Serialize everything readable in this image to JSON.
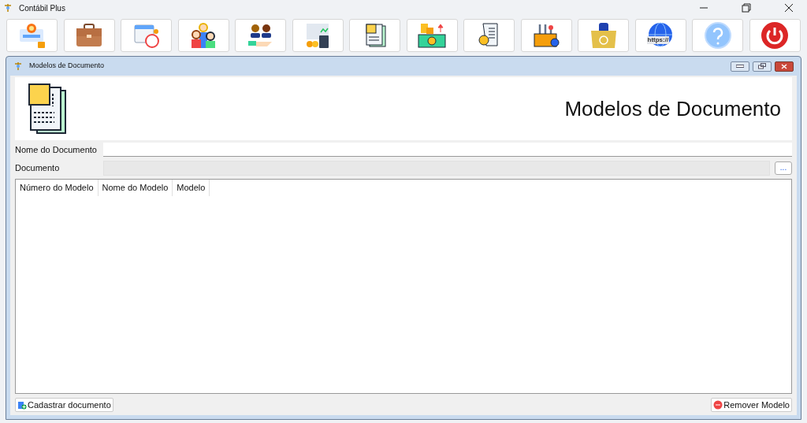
{
  "app": {
    "title": "Contábil Plus"
  },
  "toolbar": [
    {
      "kind": "user-lock"
    },
    {
      "kind": "briefcase"
    },
    {
      "kind": "calendar"
    },
    {
      "kind": "family"
    },
    {
      "kind": "handshake"
    },
    {
      "kind": "accounting"
    },
    {
      "kind": "document"
    },
    {
      "kind": "money"
    },
    {
      "kind": "receipt"
    },
    {
      "kind": "tools"
    },
    {
      "kind": "backup"
    },
    {
      "kind": "web",
      "badge_text": "https://"
    },
    {
      "kind": "help"
    },
    {
      "kind": "power"
    }
  ],
  "window": {
    "title": "Modelos de Documento",
    "heading": "Modelos de Documento"
  },
  "fields": [
    {
      "kind": "text",
      "label": "Nome do Documento"
    },
    {
      "kind": "file",
      "label": "Documento",
      "button": "..."
    }
  ],
  "table": {
    "columns": [
      "Número do Modelo",
      "Nome do Modelo",
      "Modelo"
    ]
  },
  "buttons": [
    {
      "kind": "add",
      "label": "Cadastrar documento"
    },
    {
      "kind": "remove",
      "label": "Remover Modelo"
    }
  ]
}
